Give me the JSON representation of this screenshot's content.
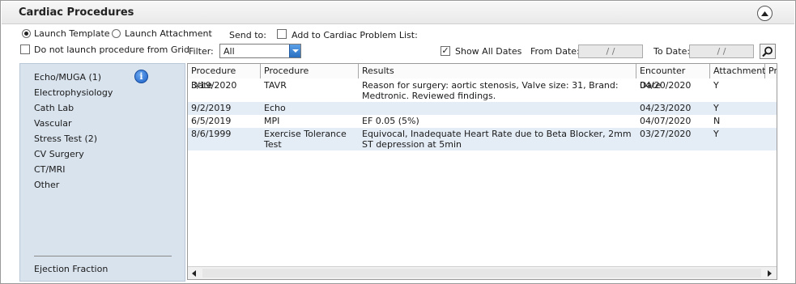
{
  "header": {
    "title": "Cardiac Procedures",
    "collapse_icon": "chevron-up-icon"
  },
  "options": {
    "launch_template": "Launch Template",
    "launch_attachment": "Launch Attachment",
    "send_to": "Send to:",
    "add_to_problem_list": "Add to Cardiac Problem List:",
    "do_not_launch": "Do not launch procedure from Grid",
    "filter_label": "Filter:",
    "filter_value": "All",
    "show_all_dates": "Show All Dates",
    "from_date_label": "From Date:",
    "from_date_value": "/ /",
    "to_date_label": "To Date:",
    "to_date_value": "/ /",
    "search_icon": "search-icon"
  },
  "sidebar": {
    "items": [
      {
        "label": "Echo/MUGA (1)"
      },
      {
        "label": "Electrophysiology"
      },
      {
        "label": "Cath Lab"
      },
      {
        "label": "Vascular"
      },
      {
        "label": "Stress Test (2)"
      },
      {
        "label": "CV Surgery"
      },
      {
        "label": "CT/MRI"
      },
      {
        "label": "Other"
      }
    ],
    "footer": "Ejection Fraction",
    "info_icon": "info-icon"
  },
  "table": {
    "columns": [
      "Procedure Date",
      "Procedure",
      "Results",
      "Encounter Date",
      "Attachment",
      "Pr"
    ],
    "rows": [
      {
        "date": "3/19/2020",
        "procedure": "TAVR",
        "results": "Reason for surgery: aortic stenosis, Valve size: 31, Brand: Medtronic.  Reviewed findings.",
        "encounter": "04/20/2020",
        "attachment": "Y"
      },
      {
        "date": "9/2/2019",
        "procedure": "Echo",
        "results": "",
        "encounter": "04/23/2020",
        "attachment": "Y"
      },
      {
        "date": "6/5/2019",
        "procedure": "MPI",
        "results": "EF 0.05 (5%)",
        "encounter": "04/07/2020",
        "attachment": "N"
      },
      {
        "date": "8/6/1999",
        "procedure": "Exercise Tolerance Test",
        "results": "Equivocal, Inadequate Heart Rate due to Beta Blocker, 2mm ST depression at 5min",
        "encounter": "03/27/2020",
        "attachment": "Y"
      }
    ]
  }
}
